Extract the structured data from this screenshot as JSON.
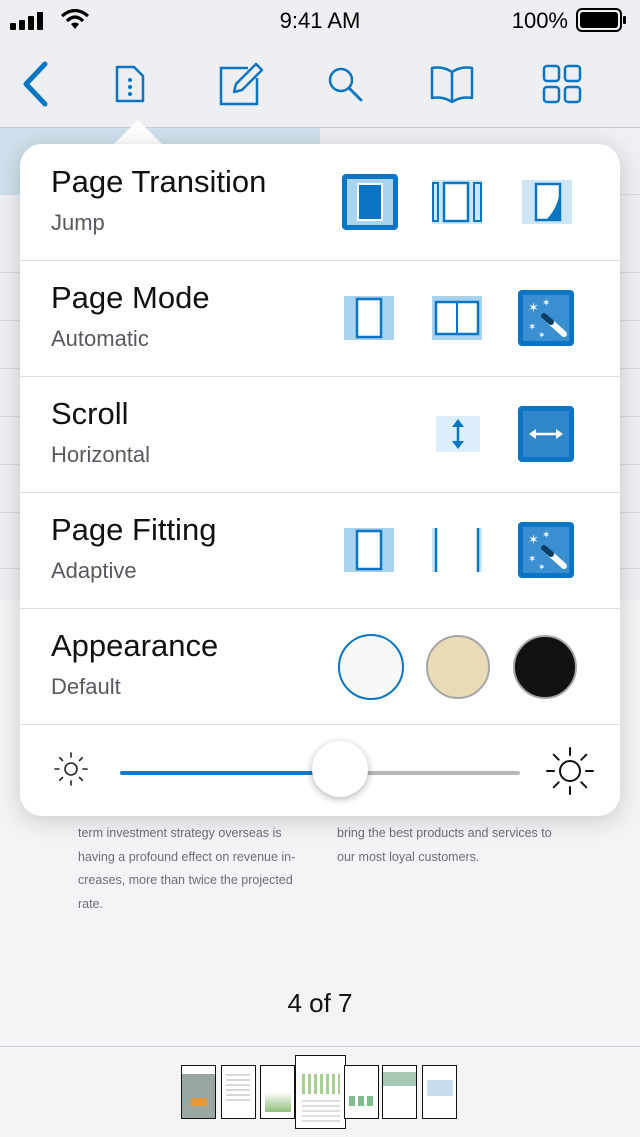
{
  "status_bar": {
    "time": "9:41 AM",
    "battery": "100%"
  },
  "toolbar": {
    "items": [
      "back-icon",
      "document-info-icon",
      "annotate-icon",
      "search-icon",
      "bookmarks-icon",
      "thumbnails-icon"
    ]
  },
  "popover": {
    "rows": [
      {
        "title": "Page Transition",
        "value": "Jump"
      },
      {
        "title": "Page Mode",
        "value": "Automatic"
      },
      {
        "title": "Scroll",
        "value": "Horizontal"
      },
      {
        "title": "Page Fitting",
        "value": "Adaptive"
      },
      {
        "title": "Appearance",
        "value": "Default"
      }
    ],
    "selected": {
      "page_transition": "jump",
      "page_mode": "automatic",
      "scroll": "horizontal",
      "page_fitting": "adaptive",
      "appearance": "default"
    },
    "brightness": 0.55
  },
  "document": {
    "left_text": [
      "term investment strategy overseas is",
      "having a profound effect on revenue in-",
      "creases, more than twice the projected",
      "rate."
    ],
    "right_text": [
      "bring the best products and services to",
      "our most loyal customers."
    ]
  },
  "page_indicator": "4 of 7",
  "colors": {
    "accent": "#0a75c2",
    "accent_light": "#a9d3ee"
  }
}
